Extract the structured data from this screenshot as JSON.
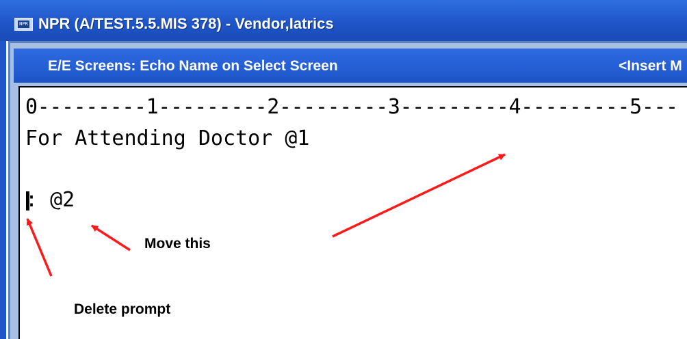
{
  "window": {
    "title": "NPR (A/TEST.5.5.MIS 378) - Vendor,Iatrics",
    "icon_name": "app-icon",
    "icon_text": "NPR"
  },
  "screen": {
    "title": "E/E Screens: Echo Name on Select Screen",
    "mode": "<Insert M"
  },
  "editor": {
    "ruler": "0---------1---------2---------3---------4---------5---",
    "lines": [
      "For Attending Doctor @1",
      ": @2"
    ]
  },
  "annotations": {
    "move_label": "Move this",
    "delete_label": "Delete prompt",
    "arrow_color": "#ff1a1a"
  }
}
